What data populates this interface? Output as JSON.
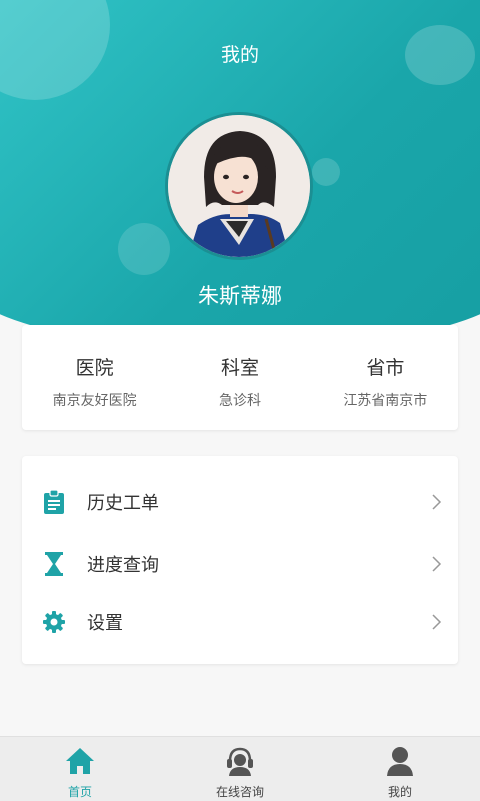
{
  "header": {
    "title": "我的",
    "username": "朱斯蒂娜"
  },
  "info": [
    {
      "label": "医院",
      "value": "南京友好医院"
    },
    {
      "label": "科室",
      "value": "急诊科"
    },
    {
      "label": "省市",
      "value": "江苏省南京市"
    }
  ],
  "menu": [
    {
      "label": "历史工单",
      "icon": "clipboard-icon"
    },
    {
      "label": "进度查询",
      "icon": "hourglass-icon"
    },
    {
      "label": "设置",
      "icon": "gear-icon"
    }
  ],
  "tabs": [
    {
      "label": "首页",
      "icon": "home-icon",
      "active": true
    },
    {
      "label": "在线咨询",
      "icon": "headset-icon",
      "active": false
    },
    {
      "label": "我的",
      "icon": "user-icon",
      "active": false
    }
  ],
  "colors": {
    "accent": "#1fa3a7",
    "header_gradient_start": "#35c9cc",
    "header_gradient_end": "#169ea2",
    "inactive_icon": "#555555"
  }
}
